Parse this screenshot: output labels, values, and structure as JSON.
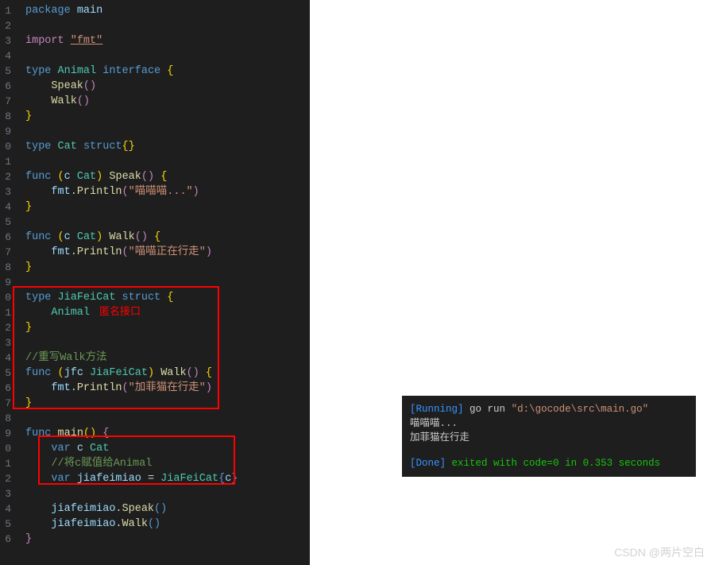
{
  "gutterStart": 1,
  "gutterEnd": 36,
  "code": {
    "l1_package": "package",
    "l1_main": "main",
    "l3_import": "import",
    "l3_fmt": "\"fmt\"",
    "l5_type": "type",
    "l5_animal": "Animal",
    "l5_interface": "interface",
    "l6_speak": "Speak",
    "l7_walk": "Walk",
    "l10_type": "type",
    "l10_cat": "Cat",
    "l10_struct": "struct",
    "l12_func": "func",
    "l12_c": "c",
    "l12_cat": "Cat",
    "l12_speak": "Speak",
    "l13_fmt": "fmt",
    "l13_println": "Println",
    "l13_str": "\"喵喵喵...\"",
    "l16_func": "func",
    "l16_walk": "Walk",
    "l17_str": "\"喵喵正在行走\"",
    "l20_type": "type",
    "l20_jiafeicat": "JiaFeiCat",
    "l20_struct": "struct",
    "l21_animal": "Animal",
    "l24_comment": "//重写Walk方法",
    "l25_func": "func",
    "l25_jfc": "jfc",
    "l25_jiafeicat": "JiaFeiCat",
    "l25_walk": "Walk",
    "l26_str": "\"加菲猫在行走\"",
    "l29_func": "func",
    "l29_main": "main",
    "l30_var": "var",
    "l30_c": "c",
    "l30_cat": "Cat",
    "l31_comment": "//将c赋值给Animal",
    "l32_var": "var",
    "l32_jiafeimiao": "jiafeimiao",
    "l32_eq": "=",
    "l32_jiafeicat": "JiaFeiCat",
    "l32_c": "c",
    "l34_jiafeimiao": "jiafeimiao",
    "l34_speak": "Speak",
    "l35_jiafeimiao": "jiafeimiao",
    "l35_walk": "Walk"
  },
  "annotations": {
    "anon_interface": "匿名接口"
  },
  "terminal": {
    "running_label": "[Running]",
    "running_cmd": "go run",
    "running_path": "\"d:\\gocode\\src\\main.go\"",
    "out1": "喵喵喵...",
    "out2": "加菲猫在行走",
    "done_label": "[Done]",
    "done_text1": "exited with code=",
    "done_code": "0",
    "done_text2": "in",
    "done_time": "0.353",
    "done_text3": "seconds"
  },
  "watermark": "CSDN @两片空白"
}
